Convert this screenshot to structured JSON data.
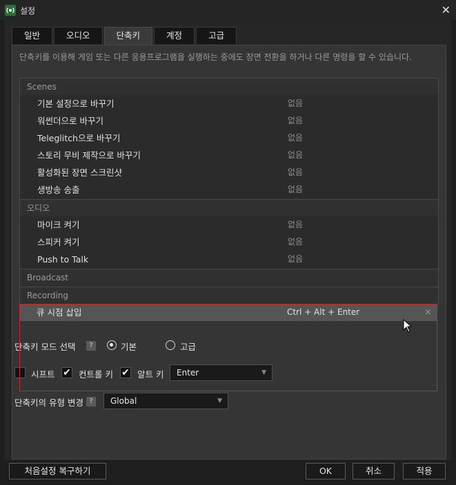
{
  "window": {
    "title": "설정"
  },
  "tabs": [
    {
      "label": "일반"
    },
    {
      "label": "오디오"
    },
    {
      "label": "단축키"
    },
    {
      "label": "계정"
    },
    {
      "label": "고급"
    }
  ],
  "active_tab": "단축키",
  "description": "단축키를 이용해 게임 또는 다른 응용프로그램을 실행하는 중에도 장면 전환을 하거나 다른 명령을 할 수 있습니다.",
  "groups": {
    "scenes": {
      "label": "Scenes",
      "items": [
        {
          "name": "기본 설정으로 바꾸기",
          "key": "없음"
        },
        {
          "name": "워썬더으로 바꾸기",
          "key": "없음"
        },
        {
          "name": "Teleglitch으로 바꾸기",
          "key": "없음"
        },
        {
          "name": "스토리 무비 제작으로 바꾸기",
          "key": "없음"
        },
        {
          "name": "활성화된 장면 스크린샷",
          "key": "없음"
        },
        {
          "name": "생방송 송출",
          "key": "없음"
        }
      ]
    },
    "audio": {
      "label": "오디오",
      "items": [
        {
          "name": "마이크 켜기",
          "key": "없음"
        },
        {
          "name": "스피커 켜기",
          "key": "없음"
        },
        {
          "name": "Push to Talk",
          "key": "없음"
        }
      ]
    },
    "broadcast": {
      "label": "Broadcast"
    },
    "recording": {
      "label": "Recording",
      "items": [
        {
          "name": "큐 시점 삽입",
          "key": "Ctrl + Alt + Enter",
          "clear": "×"
        }
      ]
    }
  },
  "hotkey_mode": {
    "label": "단축키 모드 선택",
    "help": "?",
    "options": [
      "기본",
      "고급"
    ],
    "selected": "기본"
  },
  "modifiers": {
    "shift": {
      "label": "시프트",
      "checked": false
    },
    "ctrl": {
      "label": "컨트롤 키",
      "checked": true
    },
    "alt": {
      "label": "알트 키",
      "checked": true
    },
    "key_value": "Enter"
  },
  "hotkey_type": {
    "label": "단축키의 유형 변경",
    "help": "?",
    "value": "Global"
  },
  "footer": {
    "reset": "처음설정 복구하기",
    "ok": "OK",
    "cancel": "취소",
    "apply": "적용"
  },
  "colors": {
    "accent_frame": "#c62a2a",
    "selected_row": "#555555"
  }
}
